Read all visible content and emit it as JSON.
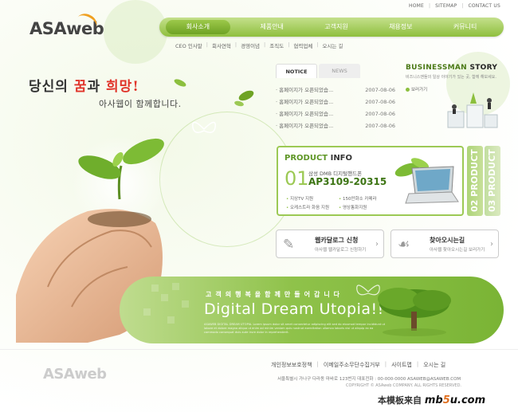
{
  "top_links": [
    "HOME",
    "SITEMAP",
    "CONTACT US"
  ],
  "logo": "ASAweb",
  "main_nav": [
    "회사소개",
    "제품안내",
    "고객지원",
    "채용정보",
    "커뮤니티"
  ],
  "sub_nav": [
    "CEO 인사말",
    "회사연혁",
    "경영이념",
    "조직도",
    "협력업체",
    "오시는 길"
  ],
  "headline": {
    "line1_a": "당신의 ",
    "line1_red1": "꿈",
    "line1_b": "과 ",
    "line1_red2": "희망",
    "line1_c": "!",
    "line2": "아사웹이 함께합니다."
  },
  "notice": {
    "tabs": [
      "NOTICE",
      "NEWS"
    ],
    "items": [
      {
        "title": "· 홈페이지가 오픈되었습...",
        "date": "2007-08-06"
      },
      {
        "title": "· 홈페이지가 오픈되었습...",
        "date": "2007-08-06"
      },
      {
        "title": "· 홈페이지가 오픈되었습...",
        "date": "2007-08-06"
      },
      {
        "title": "· 홈페이지가 오픈되었습...",
        "date": "2007-08-06"
      }
    ]
  },
  "business": {
    "title_a": "BUSINESSMAN ",
    "title_b": "STORY",
    "subtitle": "비즈니스맨들의 일상 이야기가 있는 곳, 함께 해보세요.",
    "more": "보러가기"
  },
  "product": {
    "title_a": "PRODUCT ",
    "title_b": "INFO",
    "number": "01",
    "name": "삼성 DMB 디지털핸드폰",
    "code": "AP3109-20315",
    "features": [
      "지상TV 지원",
      "150만화소 카메라",
      "오케스트라 화음 지원",
      "영상통화지원"
    ],
    "tabs": [
      "02 PRODUCT",
      "03 PRODUCT"
    ]
  },
  "buttons": [
    {
      "title": "웹카달로그 신청",
      "sub": "아사웹 웹카달로그 신청하기",
      "icon": "✎"
    },
    {
      "title": "찾아오시는길",
      "sub": "아사웹 찾아오시는길 보러가기",
      "icon": "☙"
    }
  ],
  "banner": {
    "korean": "고객의행복을함께만들어갑니다",
    "english": "Digital Dream Utopia!!",
    "tiny": "ASAWEB DIGITAL DREAM UTOPIA. Lorem ipsum dolor sit amet consectetur adipiscing elit sed do eiusmod tempor incididunt ut labore et dolore magna aliqua ut enim ad minim veniam quis nostrud exercitation ullamco laboris nisi ut aliquip ex ea commodo consequat duis aute irure dolor in reprehenderit."
  },
  "footer": {
    "logo": "ASAweb",
    "links": [
      "개인정보보호정책",
      "이메일주소무단수집거부",
      "사이트맵",
      "오시는 길"
    ],
    "address": "서울특별시 가나구 다라동 마바로 123번지   대표전화 : 00-000-0000  ASAWEB@ASAWEB.COM",
    "copyright": "COPYRIGHT © ASAweb COMPANY. ALL RIGHTS RESERVED."
  },
  "watermark": {
    "prefix": "本模板来自",
    "brand_a": "mb",
    "brand_b": "5",
    "brand_c": "u.com"
  },
  "colors": {
    "accent_green": "#8fbf3e",
    "dark_green": "#3c7413",
    "highlight_red": "#e0342a"
  }
}
